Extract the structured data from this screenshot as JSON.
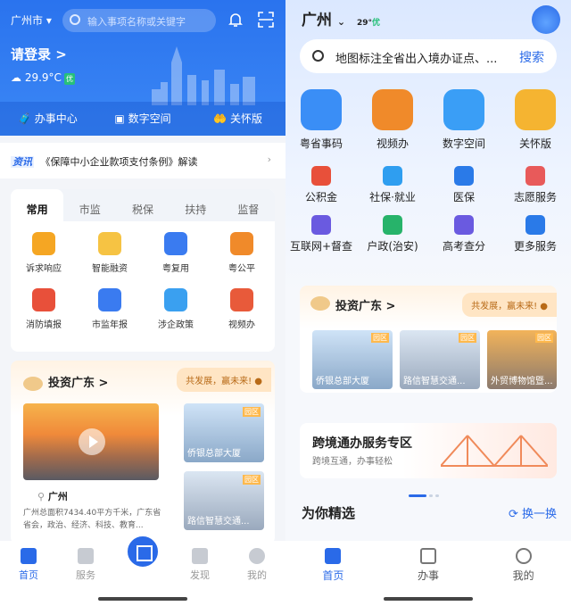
{
  "left": {
    "city": "广州市",
    "search_placeholder": "输入事项名称或关键字",
    "login": "请登录 >",
    "temp": "29.9°C",
    "air": "优",
    "quick": [
      "办事中心",
      "数字空间",
      "关怀版"
    ],
    "news_tag": "资讯",
    "news": "《保障中小企业款项支付条例》解读",
    "tabs": [
      "常用",
      "市监",
      "税保",
      "扶持",
      "监督"
    ],
    "services": [
      {
        "label": "诉求响应",
        "color": "#f5a623"
      },
      {
        "label": "智能融资",
        "color": "#f6c343"
      },
      {
        "label": "粤复用",
        "color": "#3a7bf0"
      },
      {
        "label": "粤公平",
        "color": "#f08a2a"
      },
      {
        "label": "消防填报",
        "color": "#e8503a"
      },
      {
        "label": "市监年报",
        "color": "#3a7bf0"
      },
      {
        "label": "涉企政策",
        "color": "#3aa0f0"
      },
      {
        "label": "视频办",
        "color": "#e85a3a"
      }
    ],
    "invest_title": "投资广东 >",
    "slogan": "共发展，赢未来!",
    "gz_name": "广州",
    "gz_desc": "广州总面积7434.40平方千米，广东省省会，政治、经济、科技、教育...",
    "pics": [
      "侨银总部大厦",
      "路信智慧交通..."
    ],
    "park": "园区",
    "nav": [
      "首页",
      "服务",
      "发现",
      "我的"
    ]
  },
  "right": {
    "city": "广州",
    "temp": "29°",
    "air": "优",
    "search_text": "地图标注全省出入境办证点、...",
    "search_btn": "搜索",
    "big": [
      {
        "label": "粤省事码",
        "color": "#3a8ef6"
      },
      {
        "label": "视频办",
        "color": "#f08a2a"
      },
      {
        "label": "数字空间",
        "color": "#3a9ef6"
      },
      {
        "label": "关怀版",
        "color": "#f5b431"
      }
    ],
    "small": [
      {
        "label": "公积金",
        "color": "#e8503a"
      },
      {
        "label": "社保·就业",
        "color": "#2f9ef0"
      },
      {
        "label": "医保",
        "color": "#2a7ae8"
      },
      {
        "label": "志愿服务",
        "color": "#e85a5a"
      },
      {
        "label": "互联网+督查",
        "color": "#6a5ae0"
      },
      {
        "label": "户政(治安)",
        "color": "#27b36a"
      },
      {
        "label": "高考查分",
        "color": "#6a5ae0"
      },
      {
        "label": "更多服务",
        "color": "#2a7ae8"
      }
    ],
    "invest_title": "投资广东 >",
    "slogan": "共发展，赢未来!",
    "pics": [
      "侨银总部大厦",
      "路信智慧交通...",
      "外贸博物馆暨..."
    ],
    "park": "园区",
    "cross_title": "跨境通办服务专区",
    "cross_sub": "跨境互通，办事轻松",
    "for_you": "为你精选",
    "swap": "换一换",
    "nav": [
      "首页",
      "办事",
      "我的"
    ]
  }
}
